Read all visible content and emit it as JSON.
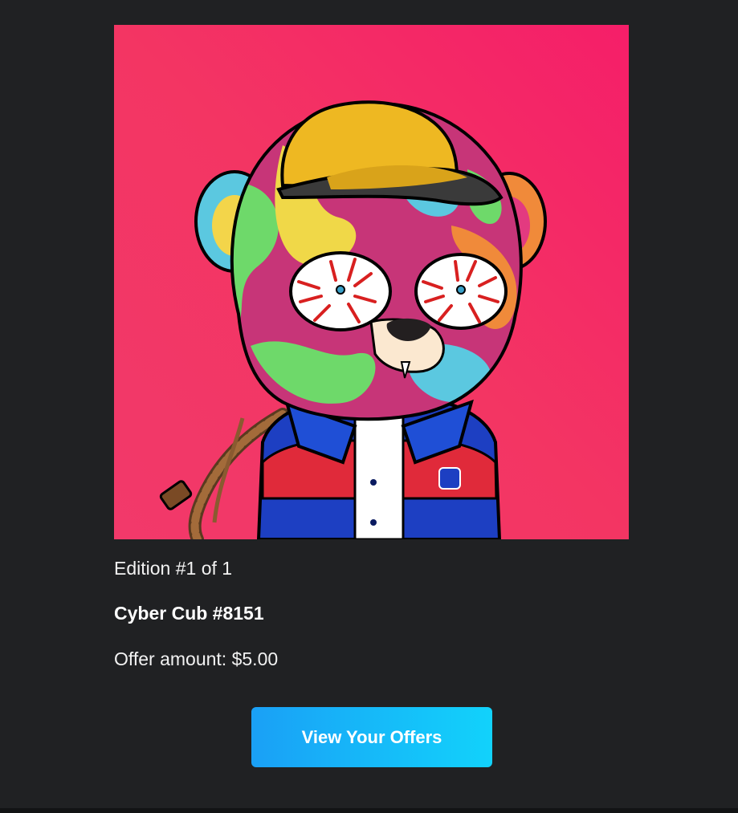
{
  "nft": {
    "image_alt": "Cyber Cub #8151 artwork",
    "edition": "Edition #1 of 1",
    "title": "Cyber Cub #8151",
    "offer_amount": "Offer amount: $5.00"
  },
  "cta": {
    "label": "View Your Offers"
  },
  "colors": {
    "background": "#202123",
    "artwork_background": "#f5336a",
    "button_start": "#1aa0f6",
    "button_end": "#12d2fb"
  }
}
